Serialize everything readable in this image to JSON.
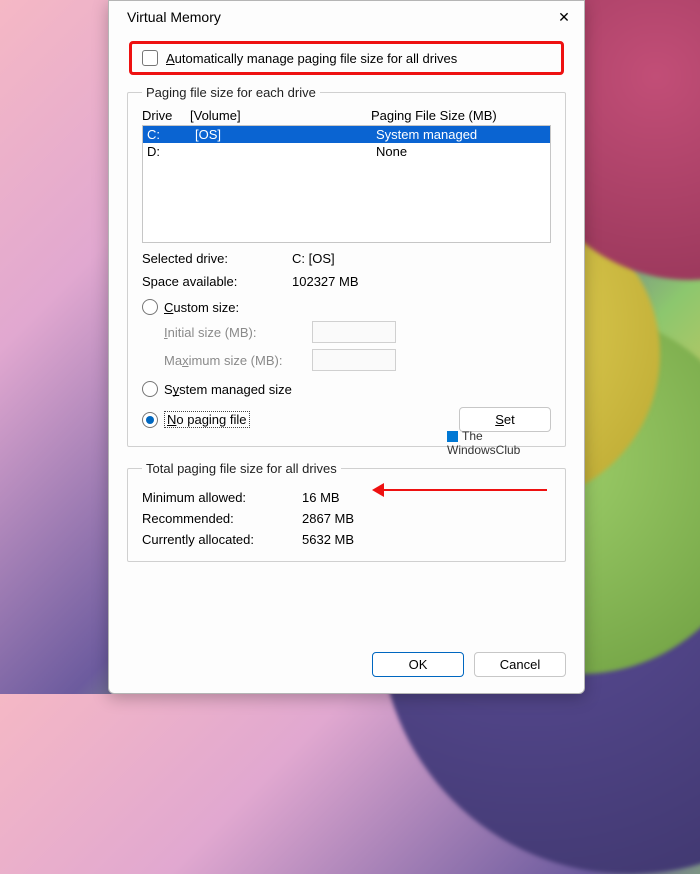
{
  "title": "Virtual Memory",
  "auto_manage_label": "Automatically manage paging file size for all drives",
  "group1_legend": "Paging file size for each drive",
  "list_headers": {
    "drive": "Drive",
    "volume": "[Volume]",
    "pfs": "Paging File Size (MB)"
  },
  "drives": [
    {
      "letter": "C:",
      "volume": "[OS]",
      "pfs": "System managed",
      "selected": true
    },
    {
      "letter": "D:",
      "volume": "",
      "pfs": "None",
      "selected": false
    }
  ],
  "selected_drive_label": "Selected drive:",
  "selected_drive_value": "C:  [OS]",
  "space_label": "Space available:",
  "space_value": "102327 MB",
  "custom_size_label": "Custom size:",
  "initial_size_label": "Initial size (MB):",
  "maximum_size_label": "Maximum size (MB):",
  "system_managed_label": "System managed size",
  "no_paging_label": "No paging file",
  "set_button": "Set",
  "group2_legend": "Total paging file size for all drives",
  "min_label": "Minimum allowed:",
  "min_value": "16 MB",
  "rec_label": "Recommended:",
  "rec_value": "2867 MB",
  "cur_label": "Currently allocated:",
  "cur_value": "5632 MB",
  "ok": "OK",
  "cancel": "Cancel",
  "watermark1": "The",
  "watermark2": "WindowsClub"
}
